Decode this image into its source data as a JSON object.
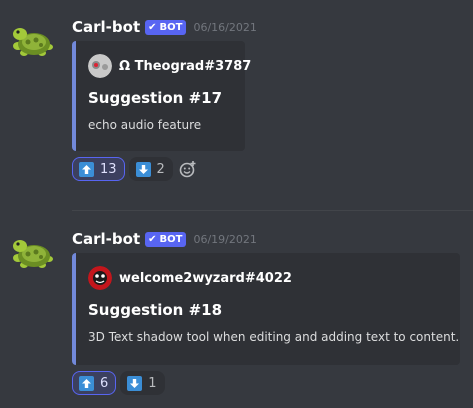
{
  "messages": [
    {
      "author": "Carl-bot",
      "bot_tag": "BOT",
      "timestamp": "06/16/2021",
      "embed": {
        "author_name": "Ω Theograd#3787",
        "title": "Suggestion #17",
        "description": "echo audio feature",
        "accent_color": "#7289da"
      },
      "reactions": [
        {
          "icon": "arrow-up-icon",
          "count": "13",
          "me": true
        },
        {
          "icon": "arrow-down-icon",
          "count": "2",
          "me": false
        }
      ]
    },
    {
      "author": "Carl-bot",
      "bot_tag": "BOT",
      "timestamp": "06/19/2021",
      "embed": {
        "author_name": "welcome2wyzard#4022",
        "title": "Suggestion #18",
        "description": "3D Text shadow tool when editing and adding text to content.",
        "accent_color": "#7289da"
      },
      "reactions": [
        {
          "icon": "arrow-up-icon",
          "count": "6",
          "me": true
        },
        {
          "icon": "arrow-down-icon",
          "count": "1",
          "me": false
        }
      ]
    }
  ],
  "colors": {
    "background": "#36393f",
    "embed_bg": "#2f3136",
    "bot_tag": "#5865f2",
    "reaction_arrow": "#3b8ed6"
  }
}
